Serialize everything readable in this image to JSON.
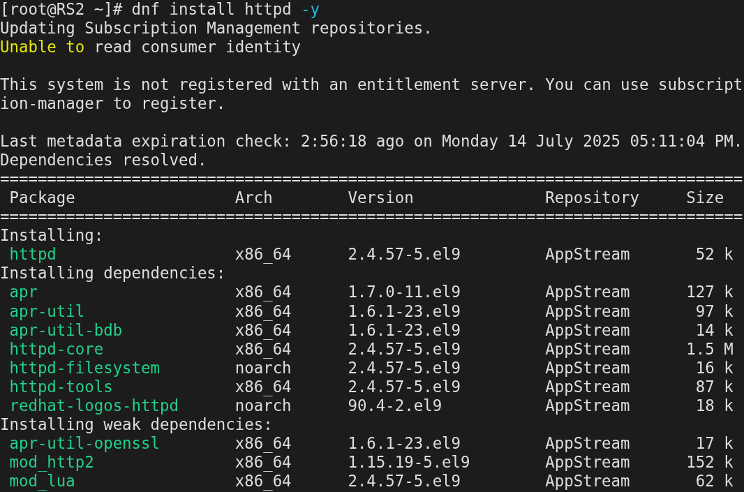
{
  "terminal": {
    "prompt": "[root@RS2 ~]#",
    "command": [
      {
        "text": "dnf install httpd"
      },
      {
        "text": "-y",
        "color": "#29b8db"
      }
    ],
    "output": [
      {
        "kind": "text",
        "text": "Updating Subscription Management repositories."
      },
      {
        "kind": "text",
        "segments": [
          {
            "text": "Unable to",
            "color": "#e5e510"
          },
          {
            "text": "read consumer identity"
          }
        ]
      },
      {
        "kind": "blank"
      },
      {
        "kind": "text",
        "text": "This system is not registered with an entitlement server. You can use subscript"
      },
      {
        "kind": "text",
        "text": "ion-manager to register."
      },
      {
        "kind": "blank"
      },
      {
        "kind": "text",
        "text": "Last metadata expiration check: 2:56:18 ago on Monday 14 July 2025 05:11:04 PM."
      },
      {
        "kind": "text",
        "text": "Dependencies resolved."
      }
    ],
    "table": {
      "rule_above_header": "===============================================================================",
      "columns": [
        "Package",
        "Arch",
        "Version",
        "Repository",
        "Size"
      ],
      "rule_below_header": "===============================================================================",
      "groups": [
        {
          "title": "Installing:",
          "rows": [
            [
              "httpd",
              "x86_64",
              "2.4.57-5.el9",
              "AppStream",
              "52 k"
            ]
          ]
        },
        {
          "title": "Installing dependencies:",
          "rows": [
            [
              "apr",
              "x86_64",
              "1.7.0-11.el9",
              "AppStream",
              "127 k"
            ],
            [
              "apr-util",
              "x86_64",
              "1.6.1-23.el9",
              "AppStream",
              "97 k"
            ],
            [
              "apr-util-bdb",
              "x86_64",
              "1.6.1-23.el9",
              "AppStream",
              "14 k"
            ],
            [
              "httpd-core",
              "x86_64",
              "2.4.57-5.el9",
              "AppStream",
              "1.5 M"
            ],
            [
              "httpd-filesystem",
              "noarch",
              "2.4.57-5.el9",
              "AppStream",
              "16 k"
            ],
            [
              "httpd-tools",
              "x86_64",
              "2.4.57-5.el9",
              "AppStream",
              "87 k"
            ],
            [
              "redhat-logos-httpd",
              "noarch",
              "90.4-2.el9",
              "AppStream",
              "18 k"
            ]
          ]
        },
        {
          "title": "Installing weak dependencies:",
          "rows": [
            [
              "apr-util-openssl",
              "x86_64",
              "1.6.1-23.el9",
              "AppStream",
              "17 k"
            ],
            [
              "mod_http2",
              "x86_64",
              "1.15.19-5.el9",
              "AppStream",
              "152 k"
            ],
            [
              "mod_lua",
              "x86_64",
              "2.4.57-5.el9",
              "AppStream",
              "62 k"
            ]
          ]
        }
      ]
    }
  }
}
